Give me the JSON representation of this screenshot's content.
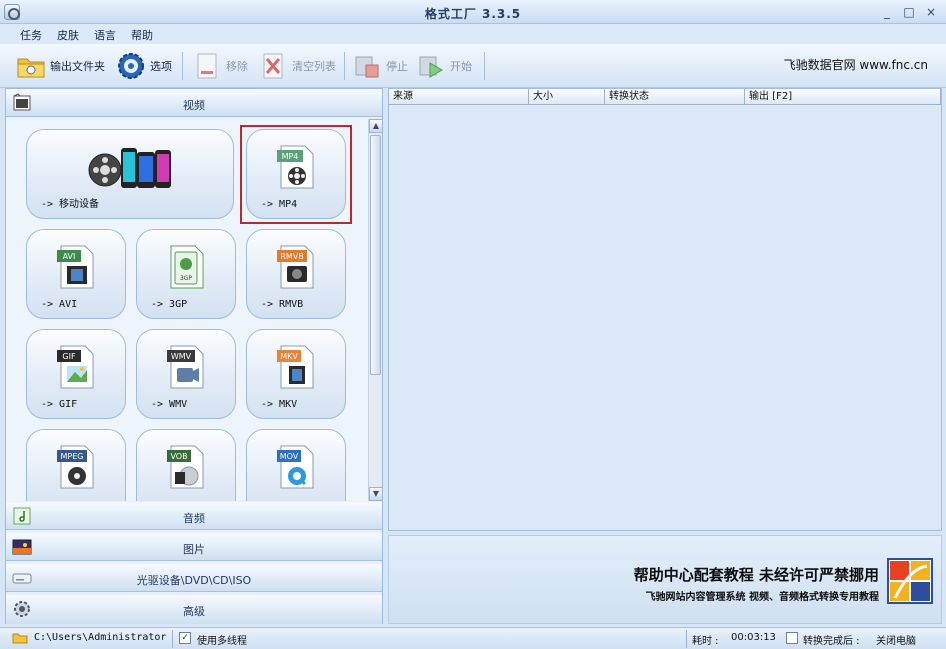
{
  "window": {
    "title": "格式工厂 3.3.5",
    "min": "_",
    "max": "□",
    "close": "×"
  },
  "menu": [
    "任务",
    "皮肤",
    "语言",
    "帮助"
  ],
  "toolbar": {
    "output_folder": "输出文件夹",
    "options": "选项",
    "remove": "移除",
    "clear_list": "清空列表",
    "stop": "停止",
    "start": "开始",
    "brand": "飞驰数据官网 www.fnc.cn"
  },
  "categories": {
    "video": "视频",
    "audio": "音频",
    "image": "图片",
    "disc": "光驱设备\\DVD\\CD\\ISO",
    "advanced": "高级"
  },
  "tiles": [
    {
      "label": "-> 移动设备",
      "badge": ""
    },
    {
      "label": "-> MP4",
      "badge": "MP4"
    },
    {
      "label": "-> AVI",
      "badge": "AVI"
    },
    {
      "label": "-> 3GP",
      "badge": "3GP"
    },
    {
      "label": "-> RMVB",
      "badge": "RMVB"
    },
    {
      "label": "-> GIF",
      "badge": "GIF"
    },
    {
      "label": "-> WMV",
      "badge": "WMV"
    },
    {
      "label": "-> MKV",
      "badge": "MKV"
    },
    {
      "label": "",
      "badge": "MPEG"
    },
    {
      "label": "",
      "badge": "VOB"
    },
    {
      "label": "",
      "badge": "MOV"
    }
  ],
  "table": {
    "columns": [
      "来源",
      "大小",
      "转换状态",
      "输出 [F2]"
    ]
  },
  "ad": {
    "main": "帮助中心配套教程 未经许可严禁挪用",
    "sub": "飞驰网站内容管理系统 视频、音频格式转换专用教程"
  },
  "status": {
    "path": "C:\\Users\\Administrator",
    "multithread_label": "使用多线程",
    "multithread_check": "✓",
    "elapsed_label": "耗时 :",
    "elapsed_value": "00:03:13",
    "after_label": "转换完成后 :",
    "after_value": "关闭电脑"
  },
  "colors": {
    "selection": "#c0272d",
    "accent": "#2f5d9b"
  }
}
